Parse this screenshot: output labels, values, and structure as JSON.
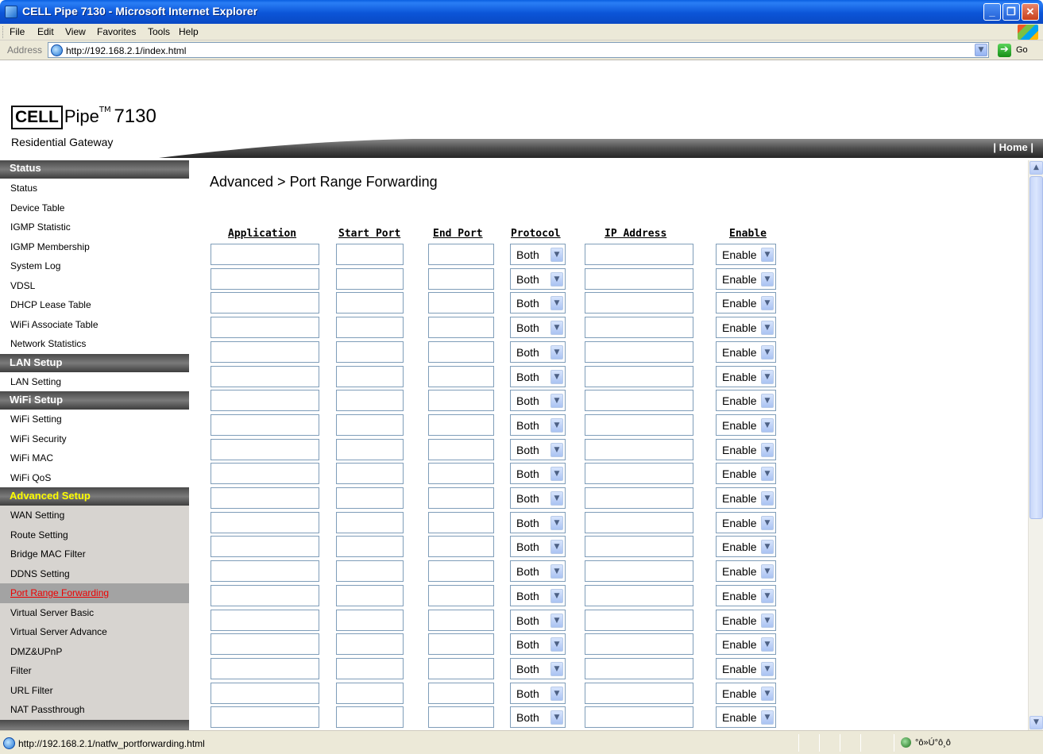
{
  "window": {
    "title": "CELL Pipe 7130 - Microsoft Internet Explorer",
    "min_glyph": "_",
    "max_glyph": "❐",
    "close_glyph": "✕"
  },
  "menu": {
    "items": [
      "File",
      "Edit",
      "View",
      "Favorites",
      "Tools",
      "Help"
    ]
  },
  "address": {
    "label": "Address",
    "url": "http://192.168.2.1/index.html",
    "go_label": "Go"
  },
  "header": {
    "logo_cell": "CELL",
    "logo_pipe": "Pipe",
    "logo_tm": "TM",
    "logo_model": "7130",
    "logo_subtitle": "Residential Gateway",
    "home_link": "| Home |"
  },
  "sidebar": {
    "sections": [
      {
        "title": "Status",
        "items": [
          "Status",
          "Device Table",
          "IGMP Statistic",
          "IGMP Membership",
          "System Log",
          "VDSL",
          "DHCP Lease Table",
          "WiFi Associate Table",
          "Network Statistics"
        ]
      },
      {
        "title": "LAN Setup",
        "items": [
          "LAN Setting"
        ]
      },
      {
        "title": "WiFi Setup",
        "items": [
          "WiFi Setting",
          "WiFi Security",
          "WiFi MAC",
          "WiFi QoS"
        ]
      },
      {
        "title": "Advanced Setup",
        "items": [
          "WAN Setting",
          "Route Setting",
          "Bridge MAC Filter",
          "DDNS Setting",
          "Port Range Forwarding",
          "Virtual Server Basic",
          "Virtual Server Advance",
          "DMZ&UPnP",
          "Filter",
          "URL Filter",
          "NAT Passthrough"
        ]
      }
    ],
    "active_item": "Port Range Forwarding"
  },
  "content": {
    "title": "Advanced > Port Range Forwarding",
    "columns": {
      "application": "Application",
      "start_port": "Start Port",
      "end_port": "End Port",
      "protocol": "Protocol",
      "ip_address": "IP Address",
      "enable": "Enable"
    },
    "rows": [
      {
        "application": "",
        "start_port": "",
        "end_port": "",
        "protocol": "Both",
        "ip_address": "",
        "enable": "Enable"
      },
      {
        "application": "",
        "start_port": "",
        "end_port": "",
        "protocol": "Both",
        "ip_address": "",
        "enable": "Enable"
      },
      {
        "application": "",
        "start_port": "",
        "end_port": "",
        "protocol": "Both",
        "ip_address": "",
        "enable": "Enable"
      },
      {
        "application": "",
        "start_port": "",
        "end_port": "",
        "protocol": "Both",
        "ip_address": "",
        "enable": "Enable"
      },
      {
        "application": "",
        "start_port": "",
        "end_port": "",
        "protocol": "Both",
        "ip_address": "",
        "enable": "Enable"
      },
      {
        "application": "",
        "start_port": "",
        "end_port": "",
        "protocol": "Both",
        "ip_address": "",
        "enable": "Enable"
      },
      {
        "application": "",
        "start_port": "",
        "end_port": "",
        "protocol": "Both",
        "ip_address": "",
        "enable": "Enable"
      },
      {
        "application": "",
        "start_port": "",
        "end_port": "",
        "protocol": "Both",
        "ip_address": "",
        "enable": "Enable"
      },
      {
        "application": "",
        "start_port": "",
        "end_port": "",
        "protocol": "Both",
        "ip_address": "",
        "enable": "Enable"
      },
      {
        "application": "",
        "start_port": "",
        "end_port": "",
        "protocol": "Both",
        "ip_address": "",
        "enable": "Enable"
      },
      {
        "application": "",
        "start_port": "",
        "end_port": "",
        "protocol": "Both",
        "ip_address": "",
        "enable": "Enable"
      },
      {
        "application": "",
        "start_port": "",
        "end_port": "",
        "protocol": "Both",
        "ip_address": "",
        "enable": "Enable"
      },
      {
        "application": "",
        "start_port": "",
        "end_port": "",
        "protocol": "Both",
        "ip_address": "",
        "enable": "Enable"
      },
      {
        "application": "",
        "start_port": "",
        "end_port": "",
        "protocol": "Both",
        "ip_address": "",
        "enable": "Enable"
      },
      {
        "application": "",
        "start_port": "",
        "end_port": "",
        "protocol": "Both",
        "ip_address": "",
        "enable": "Enable"
      },
      {
        "application": "",
        "start_port": "",
        "end_port": "",
        "protocol": "Both",
        "ip_address": "",
        "enable": "Enable"
      },
      {
        "application": "",
        "start_port": "",
        "end_port": "",
        "protocol": "Both",
        "ip_address": "",
        "enable": "Enable"
      },
      {
        "application": "",
        "start_port": "",
        "end_port": "",
        "protocol": "Both",
        "ip_address": "",
        "enable": "Enable"
      },
      {
        "application": "",
        "start_port": "",
        "end_port": "",
        "protocol": "Both",
        "ip_address": "",
        "enable": "Enable"
      },
      {
        "application": "",
        "start_port": "",
        "end_port": "",
        "protocol": "Both",
        "ip_address": "",
        "enable": "Enable"
      }
    ]
  },
  "statusbar": {
    "url": "http://192.168.2.1/natfw_portforwarding.html",
    "zone_text": "°ô»Ú°ô¸ô"
  },
  "colors": {
    "titlebar_blue": "#0b55d8",
    "section_header": "#5a5a5a",
    "advanced_header_text": "#ffff00",
    "active_link": "#ee0000",
    "field_border": "#7f9db9"
  },
  "icons": {
    "app": "ie-window-icon",
    "address": "ie-page-icon",
    "go": "green-arrow-icon",
    "status": "ie-page-icon",
    "zone": "internet-globe-icon",
    "dropdown": "chevron-down-icon"
  }
}
